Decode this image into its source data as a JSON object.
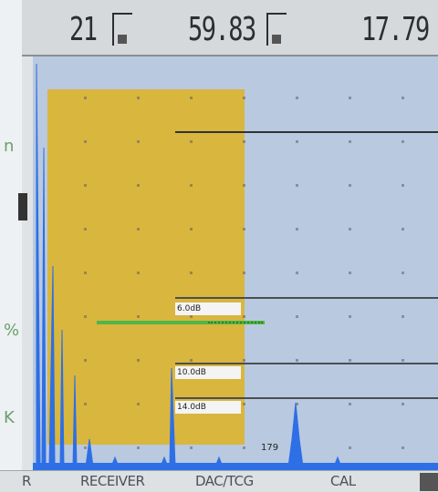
{
  "readouts": [
    {
      "value": "21"
    },
    {
      "value": "59.83"
    },
    {
      "value": "17.79"
    }
  ],
  "left_marks": [
    "n",
    "%",
    "K"
  ],
  "dac_labels": [
    "6.0dB",
    "10.0dB",
    "14.0dB"
  ],
  "peak_label": "179",
  "menu": {
    "r": "R",
    "receiver": "RECEIVER",
    "dac_tcg": "DAC/TCG",
    "cal": "CAL"
  },
  "colors": {
    "gate": "#d9b63d",
    "background": "#b9c9df",
    "echo": "#2e6fe6",
    "green_line": "#4fb648"
  }
}
